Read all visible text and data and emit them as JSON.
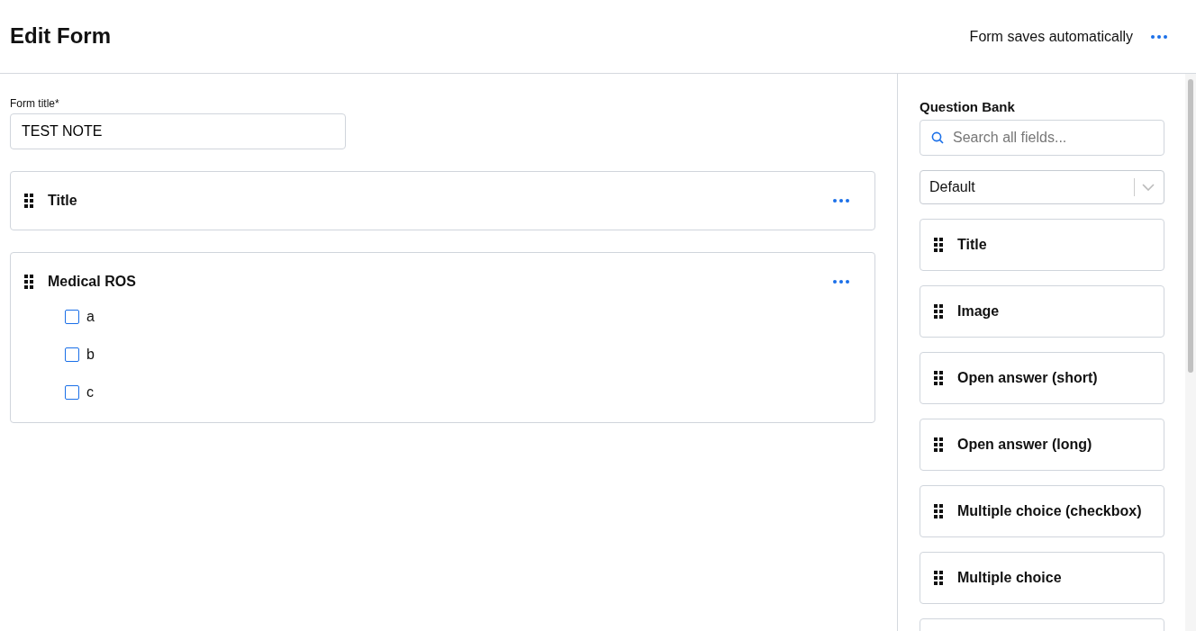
{
  "header": {
    "title": "Edit Form",
    "save_status": "Form saves automatically"
  },
  "form": {
    "title_label": "Form title*",
    "title_value": "TEST NOTE",
    "blocks": [
      {
        "title": "Title"
      },
      {
        "title": "Medical ROS",
        "options": [
          {
            "label": "a",
            "checked": false
          },
          {
            "label": "b",
            "checked": false
          },
          {
            "label": "c",
            "checked": false
          }
        ]
      }
    ]
  },
  "question_bank": {
    "heading": "Question Bank",
    "search_placeholder": "Search all fields...",
    "filter": "Default",
    "items": [
      {
        "kind": "question",
        "label": "Title"
      },
      {
        "kind": "question",
        "label": "Image"
      },
      {
        "kind": "question",
        "label": "Open answer (short)"
      },
      {
        "kind": "question",
        "label": "Open answer (long)"
      },
      {
        "kind": "question",
        "label": "Multiple choice (checkbox)"
      },
      {
        "kind": "question",
        "label": "Multiple choice"
      },
      {
        "kind": "cut_off"
      }
    ]
  }
}
